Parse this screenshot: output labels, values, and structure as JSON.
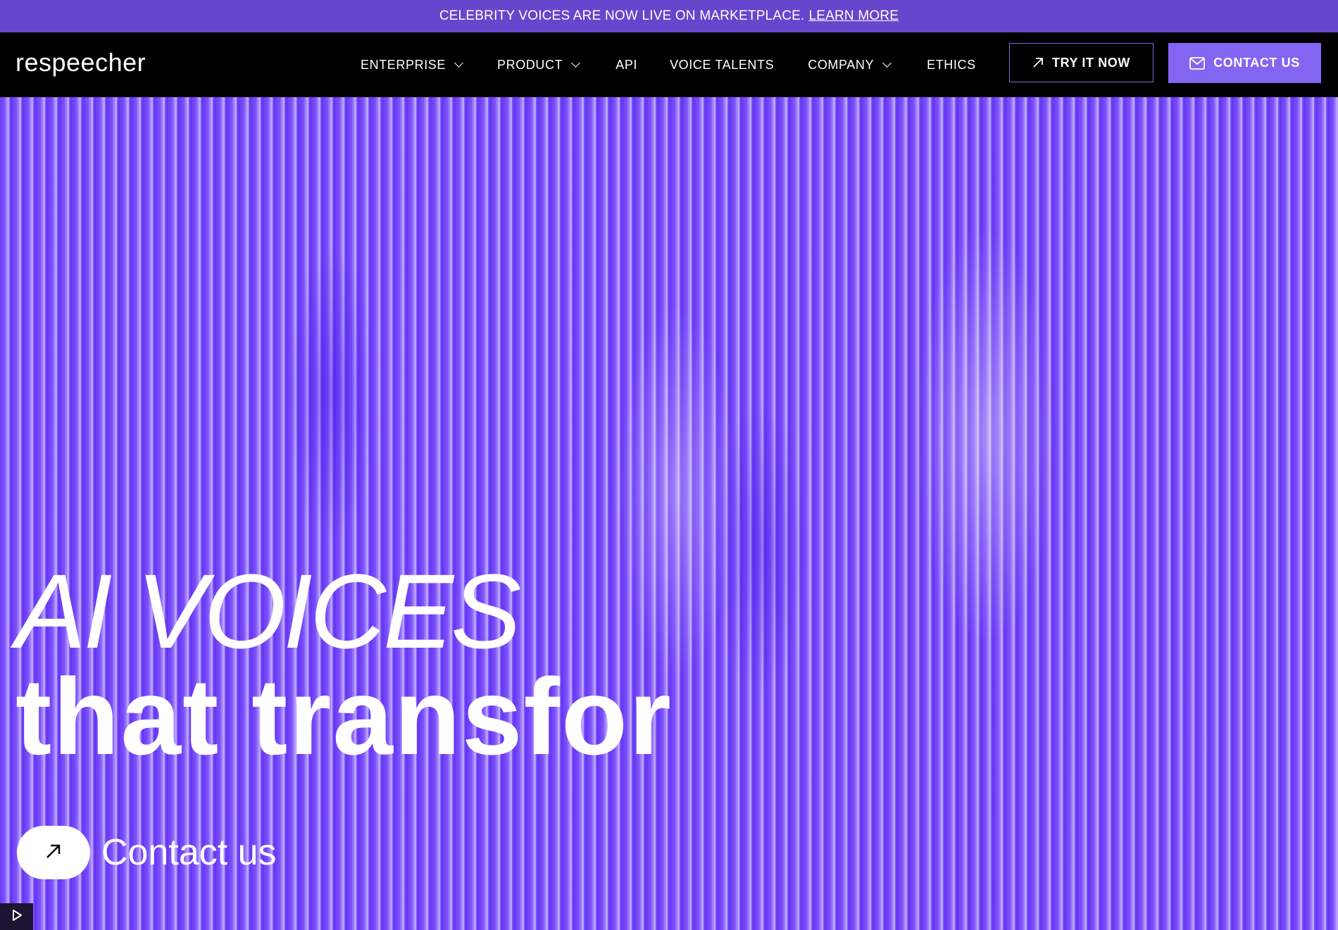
{
  "announcement": {
    "text": "CELEBRITY VOICES ARE NOW LIVE ON MARKETPLACE.",
    "link": "LEARN MORE"
  },
  "nav": {
    "logo": "respeecher",
    "items": [
      {
        "label": "ENTERPRISE",
        "has_dropdown": true
      },
      {
        "label": "PRODUCT",
        "has_dropdown": true
      },
      {
        "label": "API",
        "has_dropdown": false
      },
      {
        "label": "VOICE TALENTS",
        "has_dropdown": false
      },
      {
        "label": "COMPANY",
        "has_dropdown": true
      },
      {
        "label": "ETHICS",
        "has_dropdown": false
      }
    ],
    "try_button": {
      "label": "TRY IT NOW",
      "icon": "arrow-up-right-icon"
    },
    "contact_button": {
      "label": "CONTACT US",
      "icon": "mail-icon"
    }
  },
  "hero": {
    "title_line1": "AI VOICES",
    "title_line2": "that transfor",
    "cta_label": "Contact us",
    "cta_icon": "arrow-up-right-icon",
    "play_icon": "play-icon"
  },
  "colors": {
    "announcement_bg": "#6646cc",
    "nav_bg": "#000000",
    "accent": "#8365f2",
    "hero_bg": "#6a3cf5"
  }
}
